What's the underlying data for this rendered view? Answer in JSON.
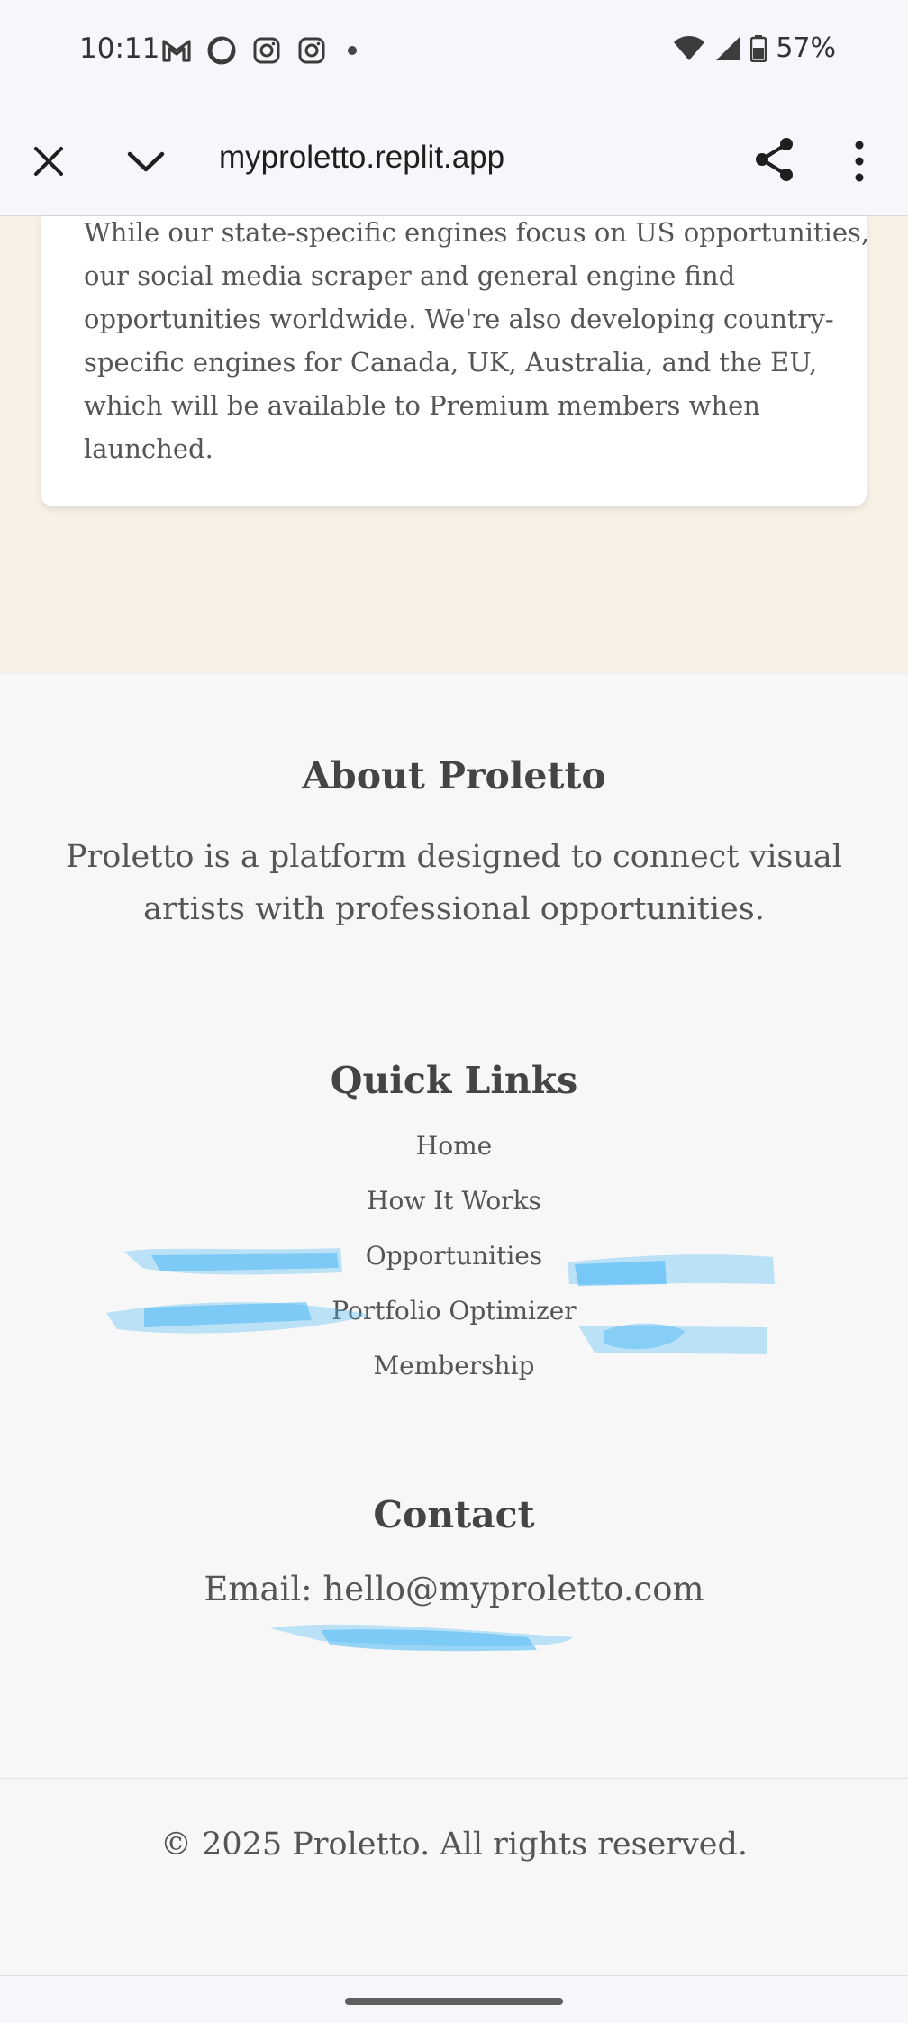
{
  "status_bar": {
    "time": "10:11",
    "notification_icons": [
      "gmail-icon",
      "sync-icon",
      "instagram-icon",
      "instagram-icon"
    ],
    "battery": "57%"
  },
  "browser": {
    "url": "myproletto.replit.app"
  },
  "card": {
    "text": "While our state-specific engines focus on US opportunities, our social media scraper and general engine find opportunities worldwide. We're also developing country-specific engines for Canada, UK, Australia, and the EU, which will be available to Premium members when launched."
  },
  "footer": {
    "about": {
      "title": "About Proletto",
      "text": "Proletto is a platform designed to connect visual artists with professional opportunities."
    },
    "quick_links": {
      "title": "Quick Links",
      "links": [
        "Home",
        "How It Works",
        "Opportunities",
        "Portfolio Optimizer",
        "Membership"
      ]
    },
    "contact": {
      "title": "Contact",
      "email": "Email: hello@myproletto.com"
    },
    "copyright": "© 2025 Proletto. All rights reserved."
  },
  "colors": {
    "cream_bg": "#f7f1e6",
    "footer_bg": "#f7f7f7",
    "scribble": "#4ab8f5"
  }
}
